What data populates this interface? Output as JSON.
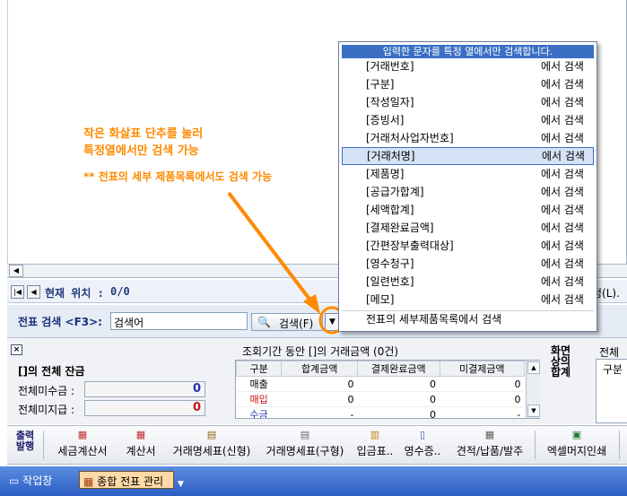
{
  "navigation": {
    "position_label": "현재 위치 :",
    "position_value": "0/0",
    "right_partial": "정(L)."
  },
  "search": {
    "label": "전표 검색 <F3>:",
    "field_value": "검색어",
    "button_label": "검색(F)"
  },
  "dropdown": {
    "header": "입력한 문자를 특정 열에서만 검색합니다.",
    "suffix": "에서 검색",
    "items": [
      "[거래번호]",
      "[구분]",
      "[작성일자]",
      "[증빙서]",
      "[거래처사업자번호]",
      "[거래처명]",
      "[제품명]",
      "[공급가합계]",
      "[세액합계]",
      "[결제완료금액]",
      "[간편장부출력대상]",
      "[영수청구]",
      "[일련번호]",
      "[메모]"
    ],
    "selected_index": 5,
    "footer": "전표의 세부제품목록에서 검색"
  },
  "annotation": {
    "line1": "작은 화살표 단추를 눌러",
    "line2": "특정열에서만 검색 가능",
    "line3": "** 전표의 세부 제품목록에서도 검색 가능",
    "color": "#ff8a00"
  },
  "balance": {
    "title": "[]의 전체 잔금",
    "rows": [
      {
        "label": "전체미수금 :",
        "value": "0",
        "color": "#1e2fb0"
      },
      {
        "label": "전체미지급 :",
        "value": "0",
        "color": "#c01818"
      }
    ]
  },
  "period": {
    "label": "조회기간 동안 []의 거래금액 (0건)",
    "columns": [
      "구분",
      "합계금액",
      "결제완료금액",
      "미결제금액"
    ],
    "rows": [
      {
        "type": "매출",
        "total": "0",
        "paid": "0",
        "unpaid": "0",
        "color": "#000000"
      },
      {
        "type": "매입",
        "total": "0",
        "paid": "0",
        "unpaid": "0",
        "color": "#d01010"
      },
      {
        "type": "수금",
        "total": "-",
        "paid": "0",
        "unpaid": "-",
        "color": "#1e2fb0"
      }
    ]
  },
  "side": {
    "title": "화면상의합계",
    "right_label": "전체",
    "right_col": "구분"
  },
  "toolbar": {
    "group_label": "출력발행",
    "buttons": [
      "세금계산서",
      "계산서",
      "거래명세표(신형)",
      "거래명세표(구형)",
      "입금표..",
      "영수증..",
      "견적/납품/발주",
      "엑셀머지인쇄"
    ]
  },
  "taskbar": {
    "items": [
      "작업창",
      "종합 전표 관리"
    ]
  }
}
